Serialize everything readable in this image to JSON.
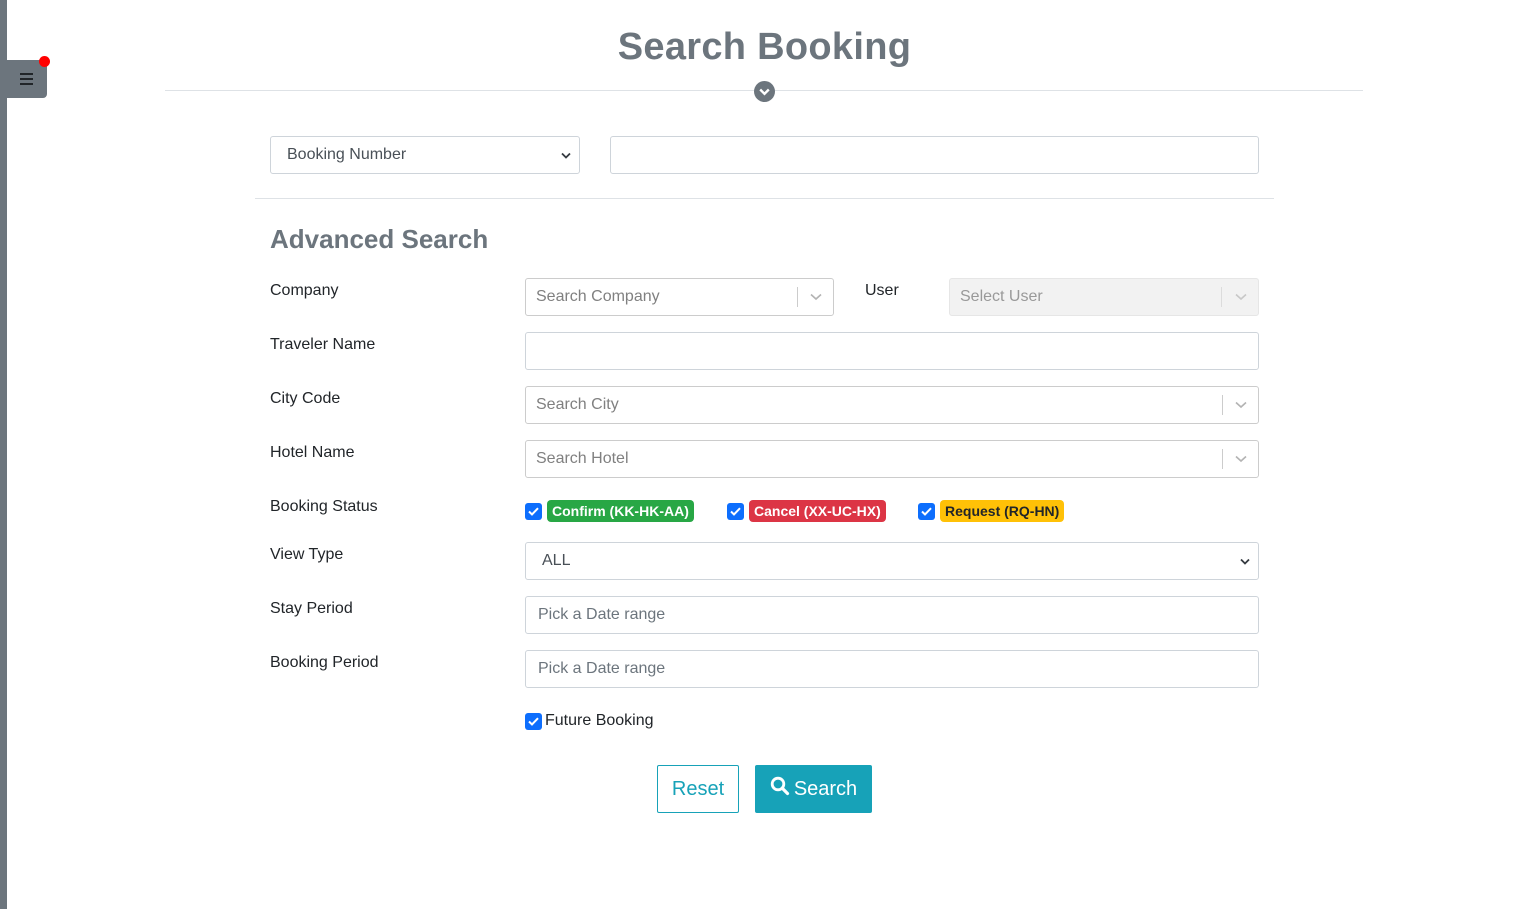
{
  "page": {
    "title": "Search Booking",
    "accent_color": "#17a2b8",
    "muted_color": "#6c757d"
  },
  "sidebar": {
    "toggle_icon": "hamburger-icon",
    "has_notification": true
  },
  "quick_search": {
    "type_selected": "Booking Number",
    "type_options": [
      "Booking Number"
    ],
    "value": ""
  },
  "advanced": {
    "heading": "Advanced Search",
    "company": {
      "label": "Company",
      "placeholder": "Search Company"
    },
    "user": {
      "label": "User",
      "placeholder": "Select User",
      "disabled": true
    },
    "traveler_name": {
      "label": "Traveler Name",
      "value": ""
    },
    "city_code": {
      "label": "City Code",
      "placeholder": "Search City"
    },
    "hotel_name": {
      "label": "Hotel Name",
      "placeholder": "Search Hotel"
    },
    "booking_status": {
      "label": "Booking Status",
      "options": [
        {
          "label": "Confirm (KK-HK-AA)",
          "checked": true,
          "color": "#28a745"
        },
        {
          "label": "Cancel (XX-UC-HX)",
          "checked": true,
          "color": "#dc3545"
        },
        {
          "label": "Request (RQ-HN)",
          "checked": true,
          "color": "#ffc107"
        }
      ]
    },
    "view_type": {
      "label": "View Type",
      "selected": "ALL"
    },
    "stay_period": {
      "label": "Stay Period",
      "placeholder": "Pick a Date range"
    },
    "booking_period": {
      "label": "Booking Period",
      "placeholder": "Pick a Date range"
    },
    "future_booking": {
      "label": "Future Booking",
      "checked": true
    }
  },
  "actions": {
    "reset_label": "Reset",
    "search_label": "Search",
    "search_icon": "search-icon"
  }
}
